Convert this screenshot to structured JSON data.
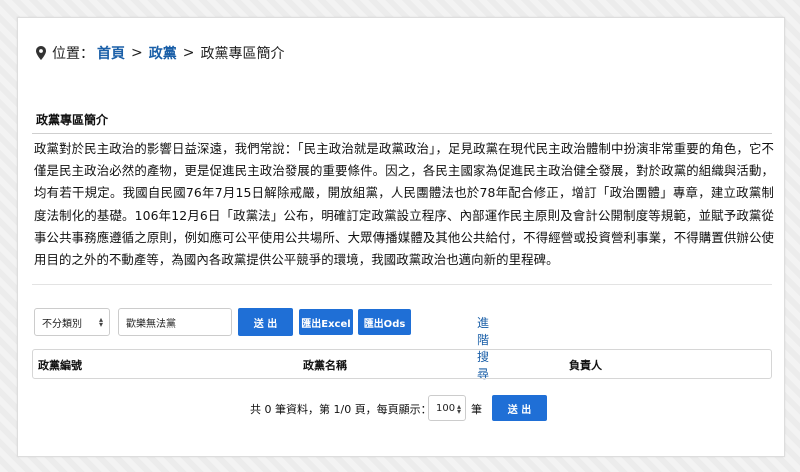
{
  "breadcrumb": {
    "label": "位置：",
    "home": "首頁",
    "separator": ">",
    "parent": "政黨",
    "current": "政黨專區簡介"
  },
  "section": {
    "title": "政黨專區簡介",
    "intro": "政黨對於民主政治的影響日益深遠，我們常說：「民主政治就是政黨政治」，足見政黨在現代民主政治體制中扮演非常重要的角色，它不僅是民主政治必然的產物，更是促進民主政治發展的重要條件。因之，各民主國家為促進民主政治健全發展，對於政黨的組織與活動，均有若干規定。我國自民國76年7月15日解除戒嚴，開放組黨，人民團體法也於78年配合修正，增訂「政治團體」專章，建立政黨制度法制化的基礎。106年12月6日「政黨法」公布，明確訂定政黨設立程序、內部運作民主原則及會計公開制度等規範，並賦予政黨從事公共事務應遵循之原則，例如應可公平使用公共場所、大眾傳播媒體及其他公共給付，不得經營或投資營利事業，不得購置供辦公使用目的之外的不動產等，為國內各政黨提供公平競爭的環境，我國政黨政治也邁向新的里程碑。"
  },
  "search": {
    "category_selected": "不分類別",
    "keyword_value": "歡樂無法黨",
    "submit_label": "送 出",
    "export_excel_label": "匯出Excel",
    "export_ods_label": "匯出Ods",
    "advanced_label": "進階搜尋"
  },
  "table": {
    "columns": [
      "政黨編號",
      "政黨名稱",
      "負責人"
    ]
  },
  "pagination": {
    "summary": "共 0 筆資料，第 1/0 頁，每頁顯示：",
    "page_size": "100",
    "unit": "筆",
    "submit_label": "送 出"
  },
  "colors": {
    "accent": "#1f6fd6",
    "link": "#1a5fa8"
  },
  "icons": {
    "location": "map-pin-icon",
    "select_caret": "caret-updown-icon"
  }
}
